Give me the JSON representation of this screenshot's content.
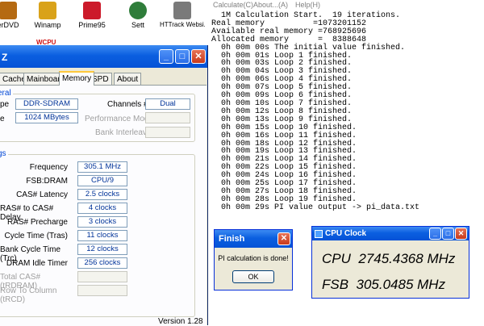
{
  "desktop": {
    "icons": [
      {
        "label": "erDVD",
        "color": "#b56a12"
      },
      {
        "label": "Winamp",
        "color": "#d9a21a"
      },
      {
        "label": "Prime95",
        "color": "#cc1a2a"
      },
      {
        "label": "Sett",
        "color": "#2f7d3a"
      },
      {
        "label": "HTTrack Websi...",
        "color": "#7a7a7a"
      }
    ],
    "partial_label": "WCPU"
  },
  "cpuz": {
    "title": "Z",
    "tabs": [
      "Cache",
      "Mainboard",
      "Memory",
      "SPD",
      "About"
    ],
    "active_tab": "Memory",
    "general": {
      "title": "eral",
      "type_label": "pe",
      "type_value": "DDR-SDRAM",
      "size_label": "e",
      "size_value": "1024 MBytes",
      "channels_label": "Channels #",
      "channels_value": "Dual",
      "perf_label": "Performance Mode",
      "interleave_label": "Bank Interleave"
    },
    "timings": {
      "title": "gs",
      "rows": [
        {
          "label": "Frequency",
          "value": "305.1 MHz",
          "enabled": true
        },
        {
          "label": "FSB:DRAM",
          "value": "CPU/9",
          "enabled": true
        },
        {
          "label": "CAS# Latency",
          "value": "2.5 clocks",
          "enabled": true
        },
        {
          "label": "RAS# to CAS# Delay",
          "value": "4 clocks",
          "enabled": true
        },
        {
          "label": "RAS# Precharge",
          "value": "3 clocks",
          "enabled": true
        },
        {
          "label": "Cycle Time (Tras)",
          "value": "11 clocks",
          "enabled": true
        },
        {
          "label": "Bank Cycle Time (Trc)",
          "value": "12 clocks",
          "enabled": true
        },
        {
          "label": "DRAM Idle Timer",
          "value": "256 clocks",
          "enabled": true
        },
        {
          "label": "Total CAS# (tRDRAM)",
          "value": "",
          "enabled": false
        },
        {
          "label": "Row To Column (tRCD)",
          "value": "",
          "enabled": false
        }
      ]
    },
    "version": "Version 1.28"
  },
  "console": {
    "menu": [
      "Calculate(C)",
      "About...(A)",
      "Help(H)"
    ],
    "lines": [
      "  1M Calculation Start.  19 iterations.",
      "Real memory          =1073201152",
      "Available real memory =768925696",
      "Allocated memory      =  8388648",
      "  0h 00m 00s The initial value finished.",
      "  0h 00m 01s Loop 1 finished.",
      "  0h 00m 03s Loop 2 finished.",
      "  0h 00m 04s Loop 3 finished.",
      "  0h 00m 06s Loop 4 finished.",
      "  0h 00m 07s Loop 5 finished.",
      "  0h 00m 09s Loop 6 finished.",
      "  0h 00m 10s Loop 7 finished.",
      "  0h 00m 12s Loop 8 finished.",
      "  0h 00m 13s Loop 9 finished.",
      "  0h 00m 15s Loop 10 finished.",
      "  0h 00m 16s Loop 11 finished.",
      "  0h 00m 18s Loop 12 finished.",
      "  0h 00m 19s Loop 13 finished.",
      "  0h 00m 21s Loop 14 finished.",
      "  0h 00m 22s Loop 15 finished.",
      "  0h 00m 24s Loop 16 finished.",
      "  0h 00m 25s Loop 17 finished.",
      "  0h 00m 27s Loop 18 finished.",
      "  0h 00m 28s Loop 19 finished.",
      "  0h 00m 29s PI value output -> pi_data.txt"
    ]
  },
  "finish_dialog": {
    "title": "Finish",
    "message": "PI calculation is done!",
    "ok_label": "OK"
  },
  "cpu_clock": {
    "title": "CPU Clock",
    "cpu_label": "CPU",
    "cpu_value": "2745.4368 MHz",
    "fsb_label": "FSB",
    "fsb_value": "305.0485 MHz"
  },
  "icons": {
    "minimize": "minimize-icon",
    "maximize": "maximize-icon",
    "close": "close-icon"
  }
}
